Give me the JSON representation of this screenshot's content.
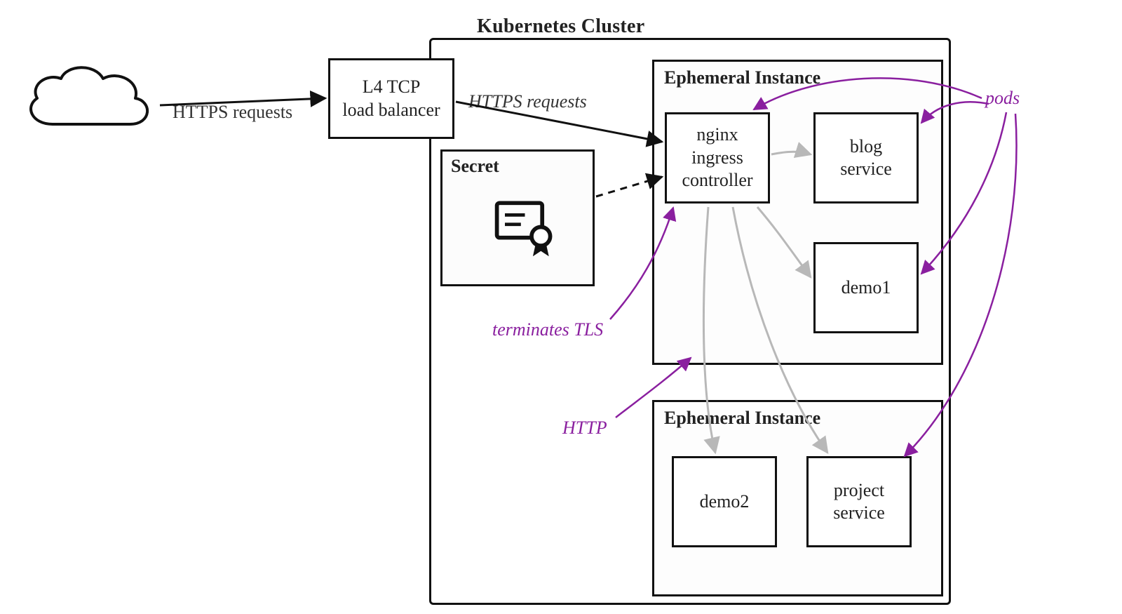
{
  "title": "Kubernetes Cluster",
  "cloud_icon": "cloud-icon",
  "https_requests1": "HTTPS requests",
  "lb_label": "L4 TCP\nload balancer",
  "https_requests2": "HTTPS requests",
  "secret": {
    "title": "Secret",
    "icon": "certificate-icon"
  },
  "instance1": {
    "title": "Ephemeral Instance",
    "pods": {
      "nginx": "nginx\ningress\ncontroller",
      "blog": "blog\nservice",
      "demo1": "demo1"
    }
  },
  "instance2": {
    "title": "Ephemeral Instance",
    "pods": {
      "demo2": "demo2",
      "project": "project\nservice"
    }
  },
  "annotations": {
    "terminates_tls": "terminates TLS",
    "http": "HTTP",
    "pods": "pods"
  },
  "colors": {
    "purple": "#8a1f9f",
    "light": "#b8b8b8",
    "black": "#111"
  }
}
